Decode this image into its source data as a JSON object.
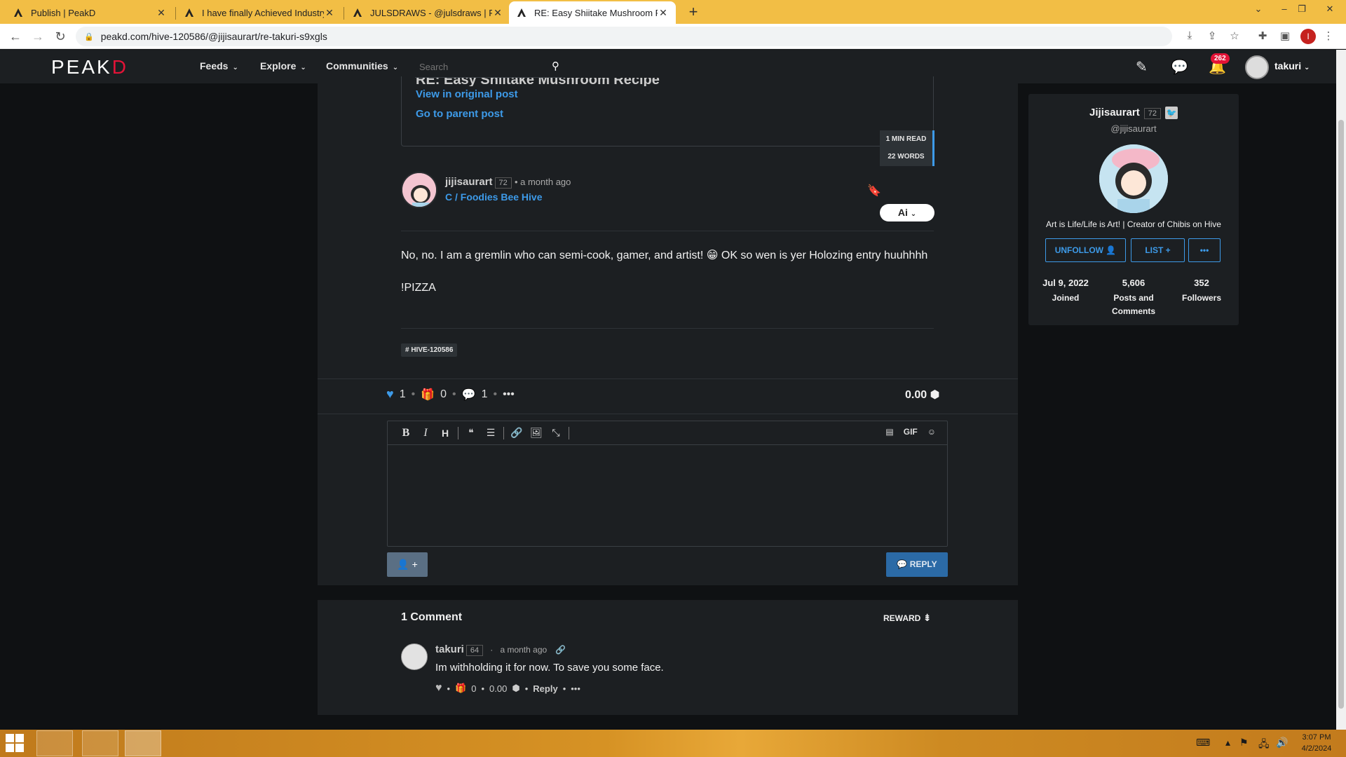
{
  "browser": {
    "tabs": [
      {
        "title": "Publish | PeakD"
      },
      {
        "title": "I have finally Achieved Industry L"
      },
      {
        "title": "JULSDRAWS - @julsdraws | Peak"
      },
      {
        "title": "RE: Easy Shiitake Mushroom Rec"
      }
    ],
    "url": "peakd.com/hive-120586/@jijisaurart/re-takuri-s9xgls",
    "profile_initial": "I"
  },
  "sitenav": {
    "logo_main": "PEAK",
    "logo_accent": "D",
    "menu": [
      "Feeds",
      "Explore",
      "Communities"
    ],
    "search_placeholder": "Search",
    "notif_count": "262",
    "username": "takuri"
  },
  "post": {
    "parent_title": "RE: Easy Shiitake Mushroom Recipe",
    "view_original": "View in original post",
    "go_parent": "Go to parent post",
    "author": "jijisaurart",
    "author_rep": "72",
    "time": "• a month ago",
    "community": "C / Foodies Bee Hive",
    "read_time": "1 MIN READ",
    "word_count": "22 WORDS",
    "ai_label": "Ai",
    "body_p1": "No, no. I am a gremlin who can semi-cook, gamer, and artist! 😁 OK so wen is yer Holozing entry huuhhhh",
    "body_p2": "!PIZZA",
    "tag": "# HIVE-120586",
    "votes": "1",
    "reblogs": "0",
    "comments": "1",
    "payout": "0.00"
  },
  "editor": {
    "gif_label": "GIF",
    "reply_label": "REPLY"
  },
  "comments": {
    "title": "1 Comment",
    "sort_label": "REWARD",
    "items": [
      {
        "author": "takuri",
        "rep": "64",
        "time": "a month ago",
        "text": "Im withholding it for now. To save you some face.",
        "reblogs": "0",
        "payout": "0.00",
        "reply_label": "Reply"
      }
    ]
  },
  "profile": {
    "name": "Jijisaurart",
    "rep": "72",
    "handle": "@jijisaurart",
    "bio": "Art is Life/Life is Art! | Creator of Chibis on Hive",
    "unfollow_label": "UNFOLLOW",
    "list_label": "LIST",
    "stats": [
      {
        "value": "Jul 9, 2022",
        "label": "Joined"
      },
      {
        "value": "5,606",
        "label": "Posts and Comments"
      },
      {
        "value": "352",
        "label": "Followers"
      }
    ]
  },
  "taskbar": {
    "time": "3:07 PM",
    "date": "4/2/2024"
  }
}
